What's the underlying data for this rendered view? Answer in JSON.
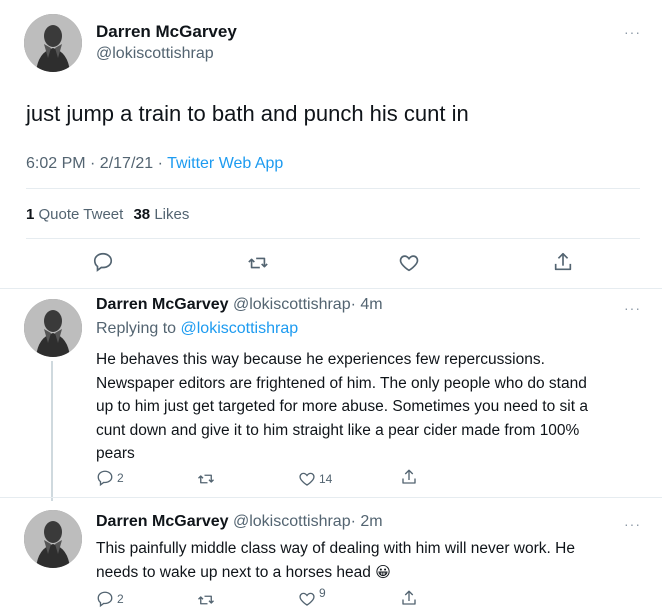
{
  "main_tweet": {
    "author_name": "Darren McGarvey",
    "handle": "@lokiscottishrap",
    "text": "just jump a train to bath and punch his cunt in",
    "time": "6:02 PM · 2/17/21 ·",
    "source": "Twitter Web App",
    "quote_tweet_count": "1",
    "quote_tweet_label": "Quote Tweet",
    "likes_count": "38",
    "likes_label": "Likes"
  },
  "replies": [
    {
      "author_name": "Darren McGarvey",
      "handle": "@lokiscottishrap",
      "time": "· 4m",
      "replying_to_label": "Replying to",
      "replying_to_handle": "@lokiscottishrap",
      "text_lines": [
        "He behaves this way because he experiences few repercussions.",
        "Newspaper editors are frightened of him. The only people who do stand",
        "up to him just get targeted for more abuse. Sometimes you need to sit a",
        "cunt down and give it to him straight like a pear cider made from 100%",
        "pears"
      ],
      "reply_count": "2",
      "like_count": "14"
    },
    {
      "author_name": "Darren McGarvey",
      "handle": "@lokiscottishrap",
      "time": "· 2m",
      "text_lines": [
        "This painfully middle class way of dealing with him will never work. He",
        "needs to wake up next to a horses head"
      ],
      "emoji": "😀",
      "reply_count": "2",
      "like_count": "9"
    }
  ],
  "icons": {
    "more": "more-icon",
    "reply": "reply-icon",
    "retweet": "retweet-icon",
    "like": "like-icon",
    "share": "share-icon"
  },
  "colors": {
    "link": "#1d9bf0",
    "muted": "#536471",
    "text": "#0f1419",
    "divider": "#e6ecf0"
  }
}
